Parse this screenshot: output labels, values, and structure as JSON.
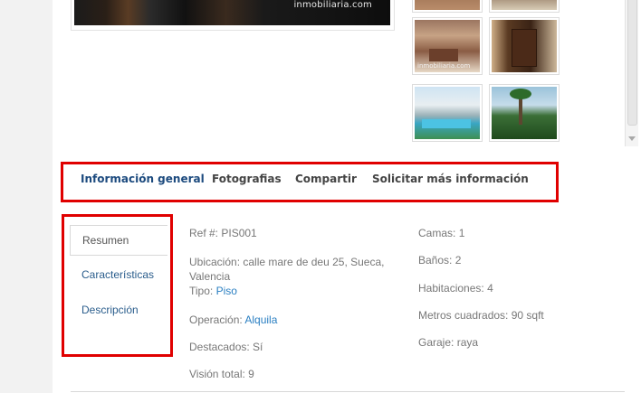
{
  "gallery": {
    "main_watermark": "inmobiliaria.com",
    "thumb_watermark": "inmobiliaria.com"
  },
  "tabs": [
    {
      "label": "Información general"
    },
    {
      "label": "Fotografias"
    },
    {
      "label": "Compartir"
    },
    {
      "label": "Solicitar más información"
    }
  ],
  "side_nav": [
    {
      "label": "Resumen"
    },
    {
      "label": "Características"
    },
    {
      "label": "Descripción"
    }
  ],
  "details_left": {
    "ref_label": "Ref #:",
    "ref_value": "PIS001",
    "location_label": "Ubicación:",
    "location_value_1": "calle mare de deu 25, Sueca,",
    "location_value_2": "Valencia",
    "type_label": "Tipo:",
    "type_value": "Piso",
    "operation_label": "Operación:",
    "operation_value": "Alquila",
    "featured_label": "Destacados:",
    "featured_value": "Sí",
    "views_label": "Visión total:",
    "views_value": "9"
  },
  "details_right": {
    "beds_label": "Camas:",
    "beds_value": "1",
    "baths_label": "Baños:",
    "baths_value": "2",
    "rooms_label": "Habitaciones:",
    "rooms_value": "4",
    "area_label": "Metros cuadrados:",
    "area_value": "90 sqft",
    "garage_label": "Garaje:",
    "garage_value": "raya"
  },
  "colors": {
    "highlight_border": "#e00000",
    "active_tab": "#1c4a7e",
    "link": "#2a7fc2"
  }
}
